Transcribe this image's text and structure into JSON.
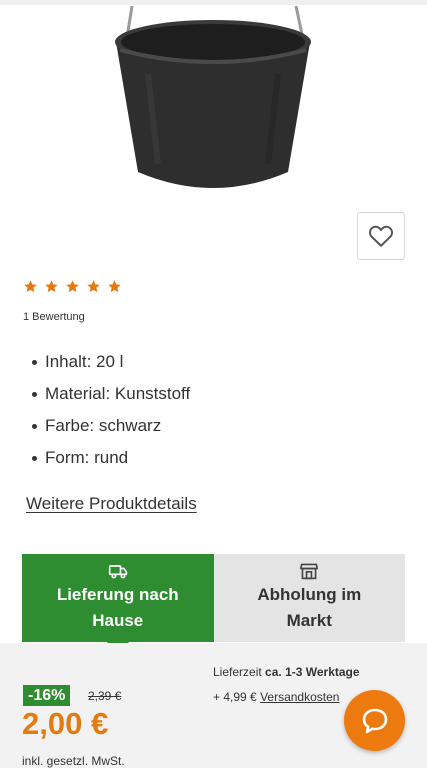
{
  "product": {
    "image_icon": "bucket-image",
    "rating": {
      "stars": 5,
      "max": 5,
      "count_label": "1 Bewertung",
      "star_color": "#e57a0f"
    },
    "features": [
      "Inhalt: 20 l",
      "Material: Kunststoff",
      "Farbe: schwarz",
      "Form: rund"
    ],
    "details_link": "Weitere Produktdetails"
  },
  "wishlist": {
    "icon": "heart-icon"
  },
  "tabs": {
    "delivery": {
      "label_line1": "Lieferung nach",
      "label_line2": "Hause",
      "icon": "truck-icon",
      "active": true,
      "color": "#2f8d31"
    },
    "pickup": {
      "label_line1": "Abholung im",
      "label_line2": "Markt",
      "icon": "store-icon",
      "active": false
    }
  },
  "delivery_info": {
    "time_label": "Lieferzeit",
    "time_value": "ca. 1-3 Werktage",
    "shipping_prefix": "+ 4,99 €",
    "shipping_link": "Versandkosten"
  },
  "pricing": {
    "discount": "-16%",
    "old_price": "2,39 €",
    "price": "2,00 €",
    "vat_note": "inkl. gesetzl. MwSt.",
    "price_color": "#e57a0f"
  },
  "chat": {
    "icon": "chat-icon",
    "color": "#ec7a0f"
  }
}
